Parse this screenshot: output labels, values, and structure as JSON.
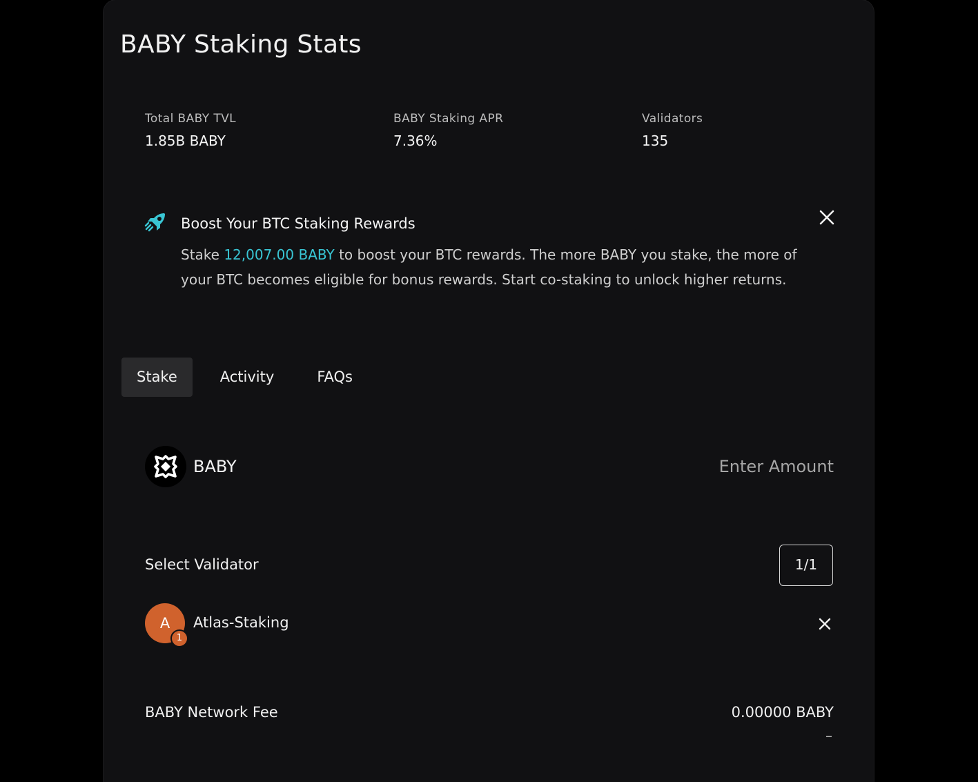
{
  "page": {
    "title": "BABY Staking Stats"
  },
  "stats": [
    {
      "label": "Total BABY TVL",
      "value": "1.85B BABY"
    },
    {
      "label": "BABY Staking APR",
      "value": "7.36%"
    },
    {
      "label": "Validators",
      "value": "135"
    }
  ],
  "boost": {
    "icon": "rocket-icon",
    "title": "Boost Your BTC Staking Rewards",
    "text_prefix": "Stake ",
    "highlight": "12,007.00 BABY",
    "text_suffix": " to boost your BTC rewards. The more BABY you stake, the more of your BTC becomes eligible for bonus rewards. Start co-staking to unlock higher returns.",
    "close_icon": "close-icon",
    "highlight_color": "#39c6d4"
  },
  "tabs": [
    {
      "label": "Stake",
      "active": true
    },
    {
      "label": "Activity",
      "active": false
    },
    {
      "label": "FAQs",
      "active": false
    }
  ],
  "stake_form": {
    "token_icon": "babylon-logo-icon",
    "token_name": "BABY",
    "amount_value": "",
    "amount_placeholder": "Enter Amount"
  },
  "validator": {
    "label": "Select Validator",
    "count": "1/1",
    "selected": {
      "avatar_letter": "A",
      "badge": "1",
      "name": "Atlas-Staking",
      "remove_icon": "close-icon",
      "avatar_color": "#d0622d"
    }
  },
  "fee": {
    "label": "BABY Network Fee",
    "value": "0.00000 BABY"
  }
}
